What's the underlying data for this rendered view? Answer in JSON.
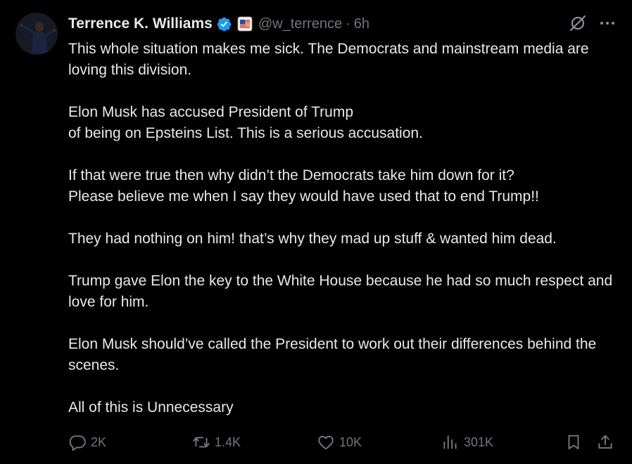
{
  "author": {
    "name": "Terrence K. Williams",
    "handle": "@w_terrence",
    "separator": "·",
    "time": "6h",
    "verified_color": "#1d9bf0"
  },
  "icons": {
    "verified": "verified-badge-icon",
    "affiliate": "flag-badge-icon",
    "grok": "grok-icon",
    "more": "more-dots-icon",
    "reply": "reply-bubble-icon",
    "repost": "repost-arrows-icon",
    "like": "heart-icon",
    "views": "analytics-bars-icon",
    "bookmark": "bookmark-icon",
    "share": "share-upload-icon"
  },
  "tweet": {
    "paragraphs": [
      "This whole situation makes me sick. The Democrats and mainstream media are loving this division.",
      "Elon Musk has accused President of Trump\nof being on Epsteins List.  This is a serious accusation.",
      "If that were true then why didn’t the Democrats take him down for it?\nPlease believe me when I say they would have used that to end Trump!!",
      "They had nothing on him! that’s why they mad up stuff &  wanted him dead.",
      "Trump gave Elon the key to the White House because he had so much respect  and love for him.",
      "Elon Musk should’ve called the President to work out their differences behind the scenes.",
      "All of this is Unnecessary"
    ]
  },
  "stats": {
    "replies": "2K",
    "reposts": "1.4K",
    "likes": "10K",
    "views": "301K"
  },
  "colors": {
    "background": "#000000",
    "text": "#e7e9ea",
    "muted": "#71767b",
    "accent": "#1d9bf0"
  }
}
